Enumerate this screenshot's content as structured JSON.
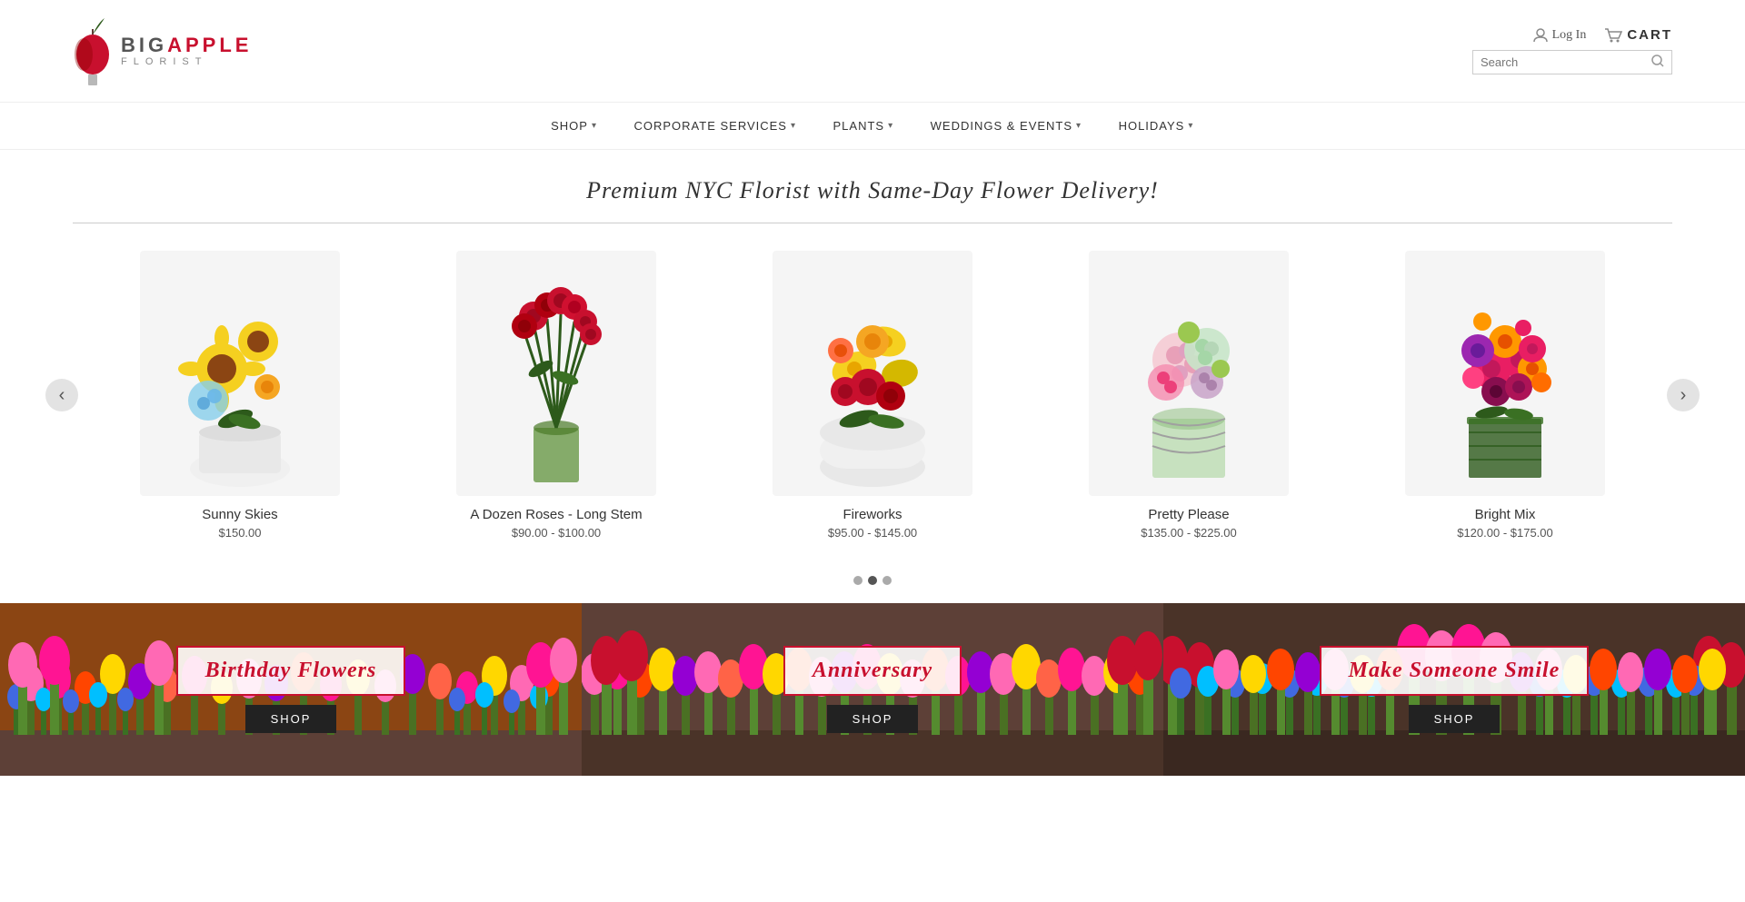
{
  "header": {
    "logo_big": "BIG",
    "logo_apple": "APPLE",
    "logo_florist": "FLORIST",
    "login_label": "Log In",
    "cart_label": "CART",
    "search_placeholder": "Search"
  },
  "nav": {
    "items": [
      {
        "label": "Shop",
        "has_dropdown": true
      },
      {
        "label": "Corporate Services",
        "has_dropdown": true
      },
      {
        "label": "Plants",
        "has_dropdown": true
      },
      {
        "label": "Weddings & Events",
        "has_dropdown": true
      },
      {
        "label": "Holidays",
        "has_dropdown": true
      }
    ]
  },
  "hero": {
    "text": "Premium NYC Florist with Same-Day Flower Delivery!"
  },
  "products": [
    {
      "name": "Sunny Skies",
      "price": "$150.00",
      "color1": "#f5d020",
      "color2": "#f5a623",
      "color3": "#87ceeb"
    },
    {
      "name": "A Dozen Roses - Long Stem",
      "price": "$90.00 - $100.00",
      "color1": "#c8102e",
      "color2": "#2d5a1b",
      "color3": "#c8102e"
    },
    {
      "name": "Fireworks",
      "price": "$95.00 - $145.00",
      "color1": "#f5a623",
      "color2": "#c8102e",
      "color3": "#f5d020"
    },
    {
      "name": "Pretty Please",
      "price": "$135.00 - $225.00",
      "color1": "#f5c6d0",
      "color2": "#d4edda",
      "color3": "#c8a2c8"
    },
    {
      "name": "Bright Mix",
      "price": "$120.00 - $175.00",
      "color1": "#e91e63",
      "color2": "#ff9800",
      "color3": "#9c27b0"
    }
  ],
  "carousel_dots": [
    {
      "active": false
    },
    {
      "active": true
    },
    {
      "active": false
    }
  ],
  "banners": [
    {
      "title": "Birthday Flowers",
      "shop_label": "SHOP",
      "bg_color": "#e8a87c"
    },
    {
      "title": "Anniversary",
      "shop_label": "SHOP",
      "bg_color": "#f48fb1"
    },
    {
      "title": "Make Someone Smile",
      "shop_label": "SHOP",
      "bg_color": "#f48fb1"
    }
  ]
}
